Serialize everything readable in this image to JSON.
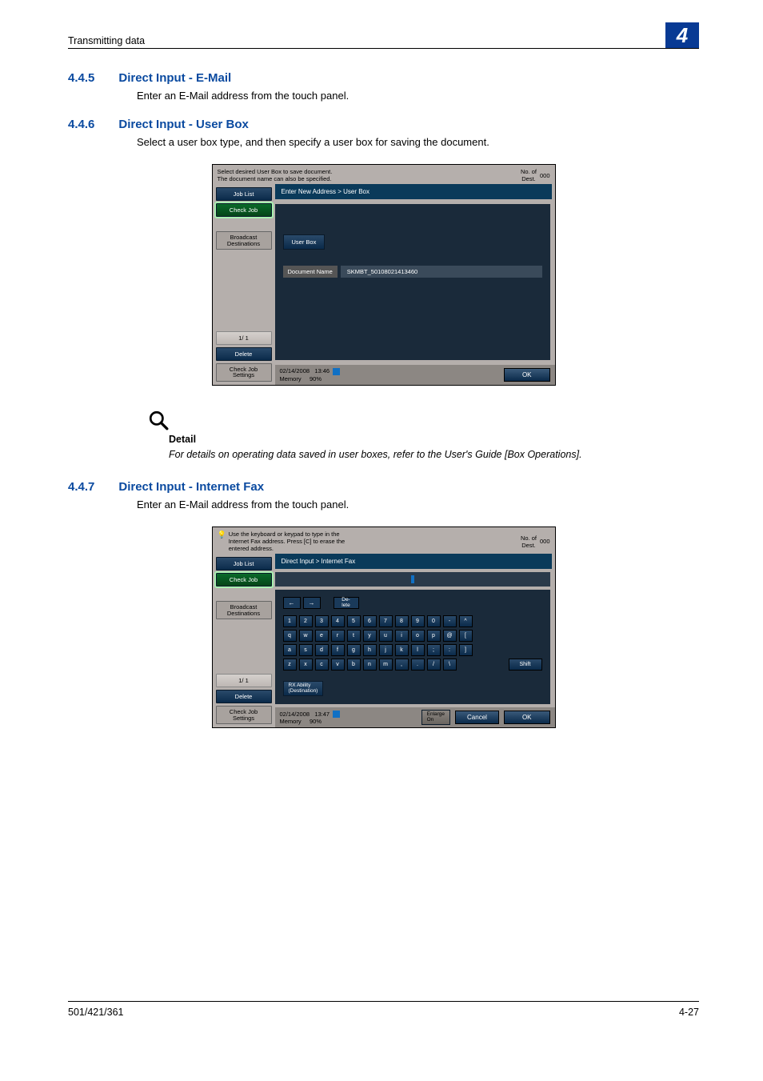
{
  "header": {
    "title": "Transmitting data",
    "section_num_badge": "4"
  },
  "s445": {
    "num": "4.4.5",
    "title": "Direct Input - E-Mail",
    "body": "Enter an E-Mail address from the touch panel."
  },
  "s446": {
    "num": "4.4.6",
    "title": "Direct Input - User Box",
    "body": "Select a user box type, and then specify a user box for saving the document."
  },
  "shot1": {
    "instruction": "Select desired User Box to save document.\nThe document name can also be specified.",
    "dest_label": "No. of\nDest.",
    "dest_count": "000",
    "breadcrumb": "Enter New Address > User Box",
    "left": {
      "job_list": "Job List",
      "check_job": "Check Job",
      "broadcast": "Broadcast\nDestinations",
      "page": "1/  1",
      "delete": "Delete",
      "check_settings": "Check Job\nSettings"
    },
    "user_box_btn": "User Box",
    "docname_label": "Document Name",
    "docname_value": "SKMBT_50108021413460",
    "status_date": "02/14/2008",
    "status_time": "13:46",
    "memory_label": "Memory",
    "memory_pct": "90%",
    "ok": "OK"
  },
  "detail": {
    "label": "Detail",
    "text": "For details on operating data saved in user boxes, refer to the User's Guide [Box Operations]."
  },
  "s447": {
    "num": "4.4.7",
    "title": "Direct Input - Internet Fax",
    "body": "Enter an E-Mail address from the touch panel."
  },
  "shot2": {
    "instruction": "Use the keyboard or keypad to type in the\nInternet Fax address. Press [C] to erase the\nentered address.",
    "dest_label": "No. of\nDest.",
    "dest_count": "000",
    "breadcrumb": "Direct Input > Internet Fax",
    "left": {
      "job_list": "Job List",
      "check_job": "Check Job",
      "broadcast": "Broadcast\nDestinations",
      "page": "1/  1",
      "delete": "Delete",
      "check_settings": "Check Job\nSettings"
    },
    "delete_btn": "De-\nlete",
    "row1": [
      "1",
      "2",
      "3",
      "4",
      "5",
      "6",
      "7",
      "8",
      "9",
      "0",
      "-",
      "^"
    ],
    "row2": [
      "q",
      "w",
      "e",
      "r",
      "t",
      "y",
      "u",
      "i",
      "o",
      "p",
      "@",
      "["
    ],
    "row3": [
      "a",
      "s",
      "d",
      "f",
      "g",
      "h",
      "j",
      "k",
      "l",
      ";",
      ":",
      "]"
    ],
    "row4": [
      "z",
      "x",
      "c",
      "v",
      "b",
      "n",
      "m",
      ",",
      ".",
      "/",
      "\\"
    ],
    "shift": "Shift",
    "rx_ability": "RX Ability\n(Destination)",
    "enlarge": "Enlarge\nOn",
    "status_date": "02/14/2008",
    "status_time": "13:47",
    "memory_label": "Memory",
    "memory_pct": "90%",
    "cancel": "Cancel",
    "ok": "OK"
  },
  "footer": {
    "left": "501/421/361",
    "right": "4-27"
  }
}
